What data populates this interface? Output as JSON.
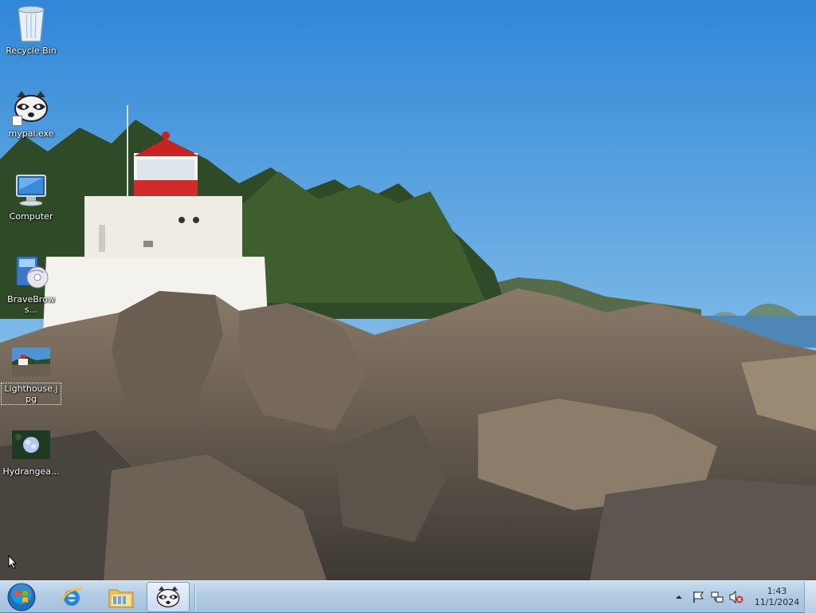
{
  "desktop": {
    "icons": [
      {
        "label": "Recycle Bin",
        "icon": "recycle-bin-icon"
      },
      {
        "label": "mypal.exe",
        "icon": "raccoon-app-icon"
      },
      {
        "label": "Computer",
        "icon": "computer-icon"
      },
      {
        "label": "BraveBrows...",
        "icon": "installer-icon"
      },
      {
        "label": "Lighthouse.jpg",
        "icon": "image-thumbnail-icon"
      },
      {
        "label": "Hydrangea...",
        "icon": "image-thumbnail-icon"
      }
    ]
  },
  "taskbar": {
    "start": "windows-orb-icon",
    "pinned": [
      {
        "name": "Internet Explorer",
        "icon": "ie-icon"
      },
      {
        "name": "Windows Explorer",
        "icon": "folder-icon"
      },
      {
        "name": "mypal",
        "icon": "raccoon-app-icon"
      }
    ],
    "tray": {
      "icons": [
        "chevron-up-icon",
        "flag-icon",
        "network-icon",
        "speaker-muted-icon"
      ],
      "time": "1:43",
      "date": "11/1/2024"
    }
  },
  "colors": {
    "taskbar": "#b3cbe4",
    "sky_top": "#2f87d8",
    "sky_bottom": "#bcdcf0",
    "lighthouse_red": "#d22a2a"
  }
}
